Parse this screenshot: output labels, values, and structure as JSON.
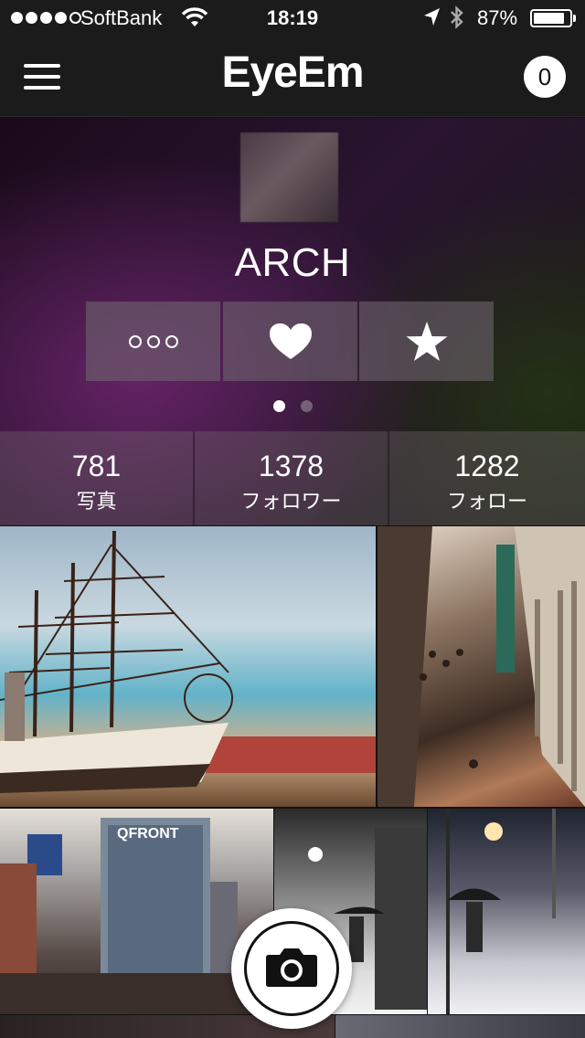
{
  "status_bar": {
    "carrier": "SoftBank",
    "time": "18:19",
    "battery_text": "87%",
    "battery_level": 0.87,
    "signal_bars_filled": 4,
    "signal_bars_total": 5,
    "icons": [
      "wifi-icon",
      "location-arrow-icon",
      "bluetooth-icon",
      "battery-icon"
    ]
  },
  "nav": {
    "title": "EyeEm",
    "notification_count": "0",
    "menu_icon": "hamburger-menu-icon"
  },
  "profile": {
    "name": "ARCH",
    "actions": [
      {
        "name": "more",
        "icon": "more-dots-icon"
      },
      {
        "name": "like",
        "icon": "heart-icon"
      },
      {
        "name": "favorite",
        "icon": "star-icon"
      }
    ],
    "page_indicator": {
      "current": 1,
      "total": 2
    }
  },
  "stats": [
    {
      "value": "781",
      "label": "写真"
    },
    {
      "value": "1378",
      "label": "フォロワー"
    },
    {
      "value": "1282",
      "label": "フォロー"
    }
  ],
  "photos": [
    {
      "subject": "tall ship"
    },
    {
      "subject": "building atrium"
    },
    {
      "subject": "shibuya street"
    },
    {
      "subject": "snowy street cyclist"
    },
    {
      "subject": "snowy road umbrella"
    }
  ],
  "camera_button": {
    "icon": "camera-icon"
  }
}
